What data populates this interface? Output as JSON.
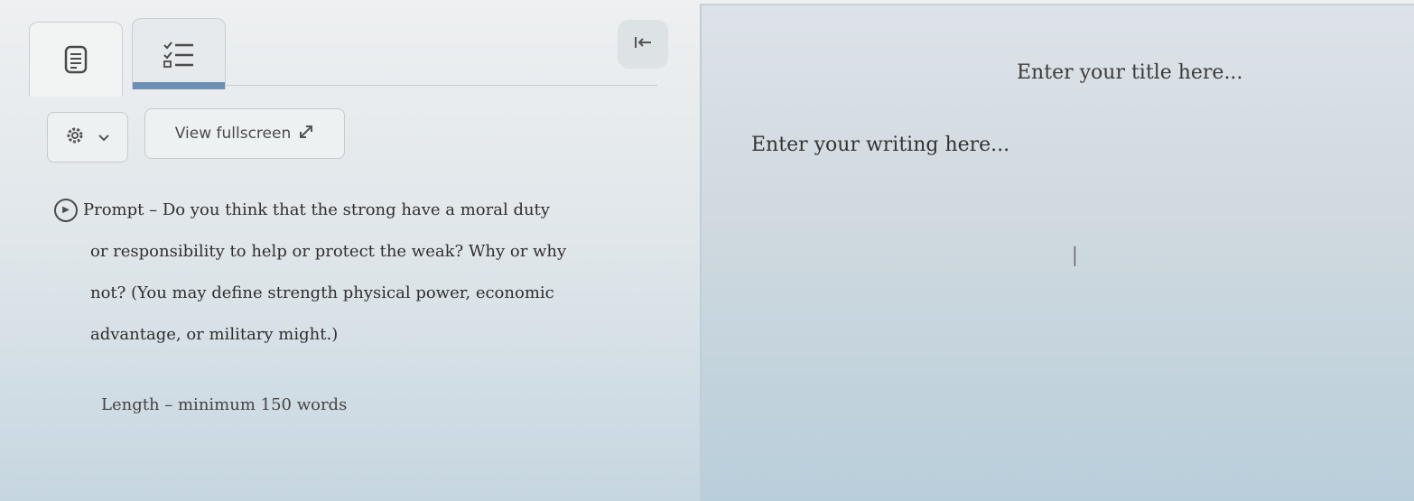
{
  "toolbar": {
    "view_fullscreen_label": "View fullscreen",
    "tabs": [
      {
        "id": "document",
        "icon": "document-icon"
      },
      {
        "id": "checklist",
        "icon": "checklist-icon"
      }
    ],
    "collapse_icon": "collapse-left-icon",
    "settings_icon": "gear-icon",
    "dropdown_icon": "chevron-down-icon",
    "fullscreen_icon": "expand-icon"
  },
  "prompt": {
    "icon": "play-icon",
    "lines": [
      "Prompt – Do you think that the strong have a moral duty",
      "or responsibility to help or protect the weak? Why or why",
      "not? (You may define strength physical power, economic",
      "advantage, or military might.)"
    ],
    "length": "Length – minimum 150 words"
  },
  "editor": {
    "title_placeholder": "Enter your title here...",
    "body_placeholder": "Enter your writing here..."
  },
  "colors": {
    "active_tab_accent": "#6d8fb4"
  }
}
